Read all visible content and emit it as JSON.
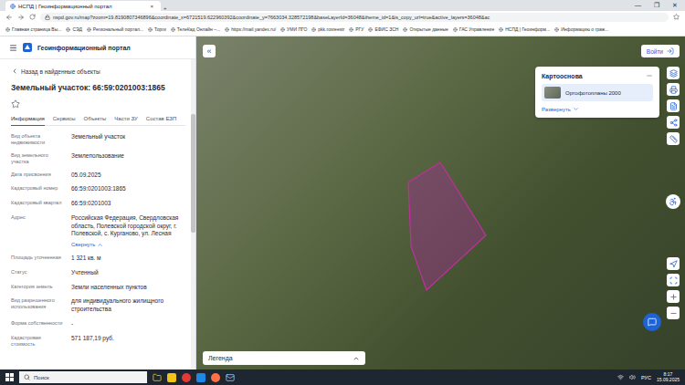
{
  "browser": {
    "tab": {
      "title": "НСПД | Геоинформационный портал",
      "close": "×"
    },
    "new_tab": "+",
    "window_controls": [
      "—",
      "❐",
      "✕"
    ],
    "address": "nspd.gov.ru/map?zoom=19.8190807346896&coordinate_x=6721519.622960392&coordinate_y=7663034.328572198&baseLayerId=36048&theme_id=1&is_copy_url=true&active_layers=36048&ac",
    "bookmarks": [
      "Главная страница Вы...",
      "СЭД",
      "Региональный портал...",
      "Торги",
      "ТелеКад Онлайн –...",
      "https://mail.yandex.ru/",
      "УМИ ПГО",
      "pkk.rosreestr",
      "РГУ",
      "ЕФИС ЗСН",
      "Открытые данные",
      "ГАС Управление",
      "НСПД | Геоинформ...",
      "Информацию о граж..."
    ]
  },
  "app": {
    "logo": "Геоинформационный портал"
  },
  "panel": {
    "back": "Назад в найденные объекты",
    "title": "Земельный участок: 66:59:0201003:1865",
    "favorite": false,
    "tabs": [
      {
        "label": "Информация",
        "selected": true
      },
      {
        "label": "Сервисы",
        "selected": false
      },
      {
        "label": "Объекты",
        "selected": false
      },
      {
        "label": "Части ЗУ",
        "selected": false
      },
      {
        "label": "Состав ЕЗП",
        "selected": false
      }
    ],
    "fields": [
      {
        "label": "Вид объекта недвижимости",
        "value": "Земельный участок"
      },
      {
        "label": "Вид земельного участка",
        "value": "Землепользование"
      },
      {
        "label": "Дата присвоения",
        "value": "05.09.2025"
      },
      {
        "label": "Кадастровый номер",
        "value": "66:59:0201003:1865"
      },
      {
        "label": "Кадастровый квартал",
        "value": "66:59:0201003"
      },
      {
        "label": "Адрес",
        "value": "Российская Федерация, Свердловская область, Полевской городской округ, г. Полевской, с. Курганово, ул. Лесная",
        "toggle": "Свернуть"
      },
      {
        "label": "Площадь уточненная",
        "value": "1 321 кв. м"
      },
      {
        "label": "Статус",
        "value": "Учтенный"
      },
      {
        "label": "Категория земель",
        "value": "Земли населенных пунктов"
      },
      {
        "label": "Вид разрешенного использования",
        "value": "для индивидуального жилищного строительства"
      },
      {
        "label": "Форма собственности",
        "value": "-"
      },
      {
        "label": "Кадастровая стоимость",
        "value": "571 187,19 руб."
      }
    ]
  },
  "map": {
    "collapse": "«",
    "login": "Войти",
    "basemap": {
      "title": "Картооснова",
      "item": "Ортофотопланы 2000",
      "item_selected": true,
      "expand": "Развернуть"
    },
    "legend": "Легенда",
    "parcel_selected": true
  },
  "taskbar": {
    "search": "Поиск",
    "language": "РУС",
    "time": "8:17",
    "date": "15.09.2025"
  }
}
